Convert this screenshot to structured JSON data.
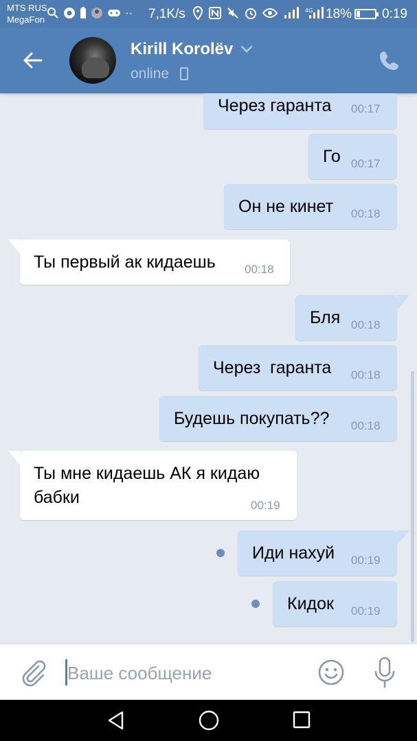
{
  "status_bar": {
    "carrier_1": "MTS RUS",
    "carrier_2": "MegaFon",
    "left_icons": [
      "search-icon",
      "chrome-icon",
      "battery-saver-icon",
      "avatar-icon",
      "game-icon",
      "dots-icon"
    ],
    "net_speed": "7,1K/s",
    "right_icons": [
      "location-icon",
      "nfc-icon",
      "mute-icon",
      "alarm-icon",
      "eye-icon",
      "signal-icon",
      "signal-4g-icon"
    ],
    "battery_percent": "18%",
    "time": "0:19"
  },
  "header": {
    "contact_name": "Kirill Korolëv",
    "status": "online",
    "colors": {
      "bar": "#5181b8",
      "status_text": "#b5cbe5"
    }
  },
  "messages": [
    {
      "direction": "out",
      "text": "Через гаранта",
      "time": "00:17"
    },
    {
      "direction": "out",
      "text": "Го",
      "time": "00:17"
    },
    {
      "direction": "out",
      "text": "Он не кинет",
      "time": "00:18"
    },
    {
      "direction": "in",
      "text": "Ты первый ак кидаешь",
      "time": "00:18"
    },
    {
      "direction": "out",
      "text": "Бля",
      "time": "00:18"
    },
    {
      "direction": "out",
      "text": "Через  гаранта",
      "time": "00:18"
    },
    {
      "direction": "out",
      "text": "Будешь покупать??",
      "time": "00:18"
    },
    {
      "direction": "in",
      "text_line1": "Ты мне кидаешь АК я кидаю",
      "text_line2": "бабки",
      "time": "00:19"
    },
    {
      "direction": "out",
      "text": "Иди нахуй",
      "time": "00:19",
      "unread": true
    },
    {
      "direction": "out",
      "text": "Кидок",
      "time": "00:19",
      "unread": true
    }
  ],
  "input_bar": {
    "placeholder": "Ваше сообщение",
    "value": ""
  },
  "colors": {
    "chat_bg": "#e6ebf1",
    "outgoing_bubble": "#cddff4",
    "incoming_bubble": "#ffffff",
    "timestamp": "#8a99ab",
    "unread_dot": "#6d8fbb"
  }
}
